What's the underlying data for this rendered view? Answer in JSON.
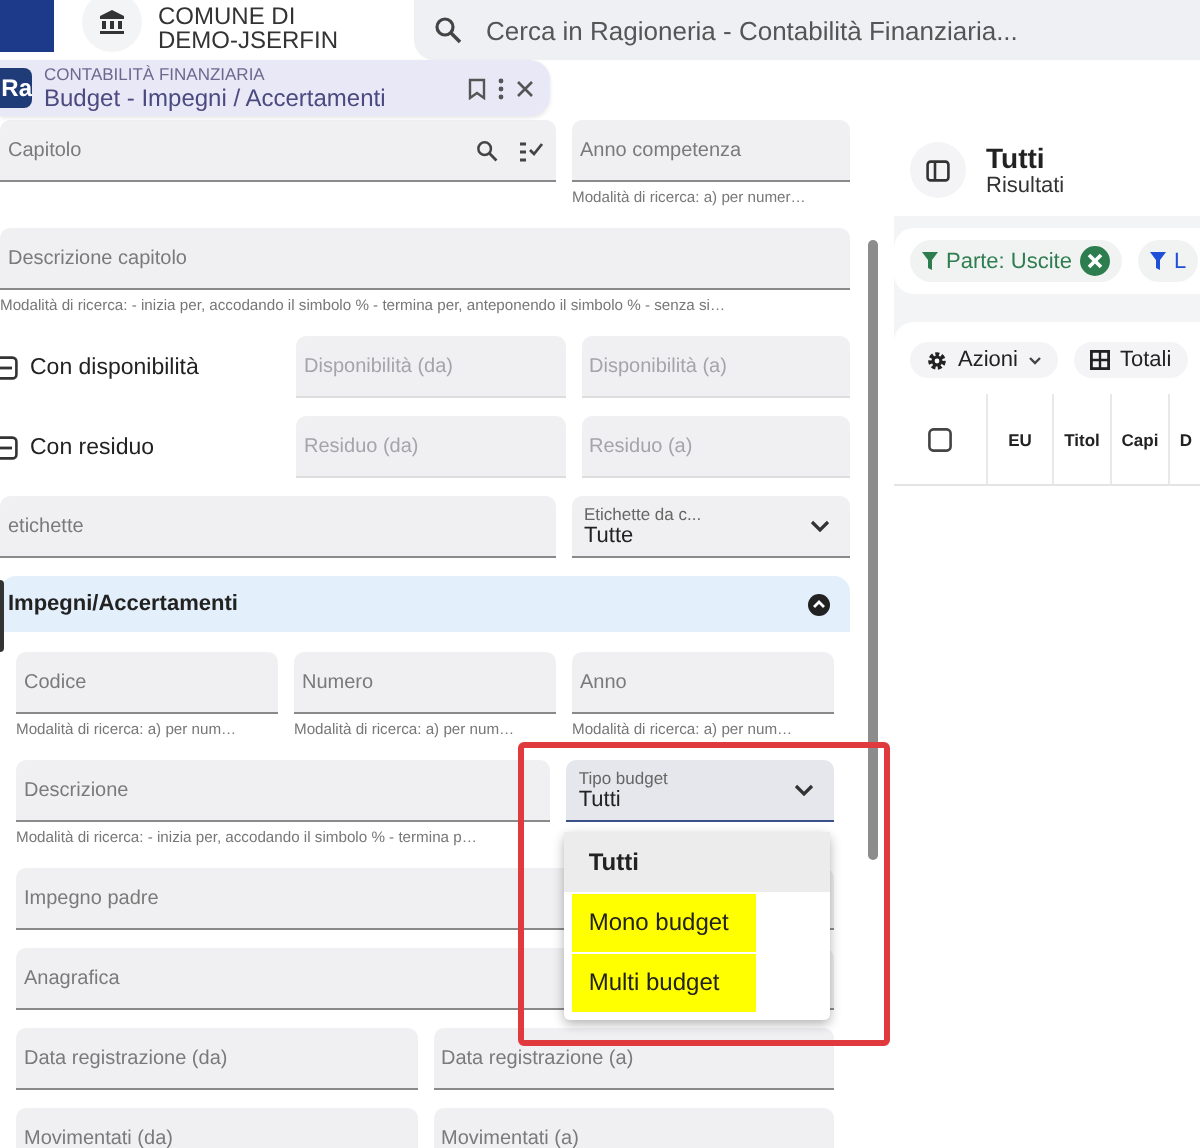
{
  "organization": {
    "line_1": "COMUNE DI",
    "line_2": "DEMO-JSERFIN"
  },
  "search": {
    "placeholder": "Cerca in Ragioneria - Contabilità Finanziaria..."
  },
  "document_tab": {
    "app_badge": "Ra",
    "section": "CONTABILITÀ FINANZIARIA",
    "title": "Budget - Impegni / Accertamenti"
  },
  "filters": {
    "rows": [
      {
        "fields": [
          {
            "kind": "lookup",
            "label": "Capitolo"
          },
          {
            "kind": "text",
            "label": "Anno competenza",
            "hint": "Modalità di ricerca: a) per numer…"
          }
        ]
      },
      {
        "fields": [
          {
            "kind": "text",
            "label": "Descrizione capitolo",
            "hint": "Modalità di ricerca: - inizia per, accodando il simbolo % - termina per, anteponendo il simbolo % - senza si…"
          }
        ]
      },
      {
        "fields": [
          {
            "kind": "check",
            "label": "Con disponibilità",
            "indeterminate": true
          },
          {
            "kind": "text",
            "label": "Disponibilità (da)",
            "disabled": true
          },
          {
            "kind": "text",
            "label": "Disponibilità (a)",
            "disabled": true
          }
        ]
      },
      {
        "fields": [
          {
            "kind": "check",
            "label": "Con residuo",
            "indeterminate": true
          },
          {
            "kind": "text",
            "label": "Residuo (da)",
            "disabled": true
          },
          {
            "kind": "text",
            "label": "Residuo (a)",
            "disabled": true
          }
        ]
      },
      {
        "fields": [
          {
            "kind": "text",
            "label": "etichette"
          },
          {
            "kind": "select",
            "label": "Etichette da c...",
            "value": "Tutte"
          }
        ]
      }
    ],
    "section": {
      "title": "Impegni/Accertamenti",
      "expanded": true,
      "rows": [
        {
          "fields": [
            {
              "kind": "text",
              "label": "Codice",
              "hint": "Modalità di ricerca: a) per num…"
            },
            {
              "kind": "text",
              "label": "Numero",
              "hint": "Modalità di ricerca: a) per num…"
            },
            {
              "kind": "text",
              "label": "Anno",
              "hint": "Modalità di ricerca: a) per num…"
            }
          ]
        },
        {
          "fields": [
            {
              "kind": "text",
              "label": "Descrizione",
              "hint": "Modalità di ricerca: - inizia per, accodando il simbolo % - termina p…"
            },
            {
              "kind": "select",
              "label": "Tipo budget",
              "value": "Tutti",
              "open": true
            }
          ]
        },
        {
          "fields": [
            {
              "kind": "text",
              "label": "Impegno padre"
            }
          ]
        },
        {
          "fields": [
            {
              "kind": "text",
              "label": "Anagrafica"
            }
          ]
        },
        {
          "fields": [
            {
              "kind": "text",
              "label": "Data registrazione (da)"
            },
            {
              "kind": "text",
              "label": "Data registrazione (a)"
            }
          ]
        },
        {
          "fields": [
            {
              "kind": "text",
              "label": "Movimentati (da)"
            },
            {
              "kind": "text",
              "label": "Movimentati (a)"
            }
          ]
        }
      ]
    }
  },
  "budget_menu": {
    "options": [
      {
        "label": "Tutti",
        "selected": true,
        "highlighted": false
      },
      {
        "label": "Mono budget",
        "selected": false,
        "highlighted": true
      },
      {
        "label": "Multi budget",
        "selected": false,
        "highlighted": true
      }
    ]
  },
  "results": {
    "title": "Tutti",
    "subtitle": "Risultati",
    "chips": [
      {
        "label": "Parte: Uscite",
        "color": "#2e7d4f",
        "removable": true
      },
      {
        "label": "L",
        "color": "#1f4fd8",
        "removable": false
      }
    ],
    "toolbar": [
      {
        "label": "Azioni",
        "dropdown": true
      },
      {
        "label": "Totali",
        "dropdown": false
      }
    ],
    "table": {
      "select_all_checked": false,
      "columns": [
        "EU",
        "Titol",
        "Capi",
        "D"
      ]
    }
  }
}
